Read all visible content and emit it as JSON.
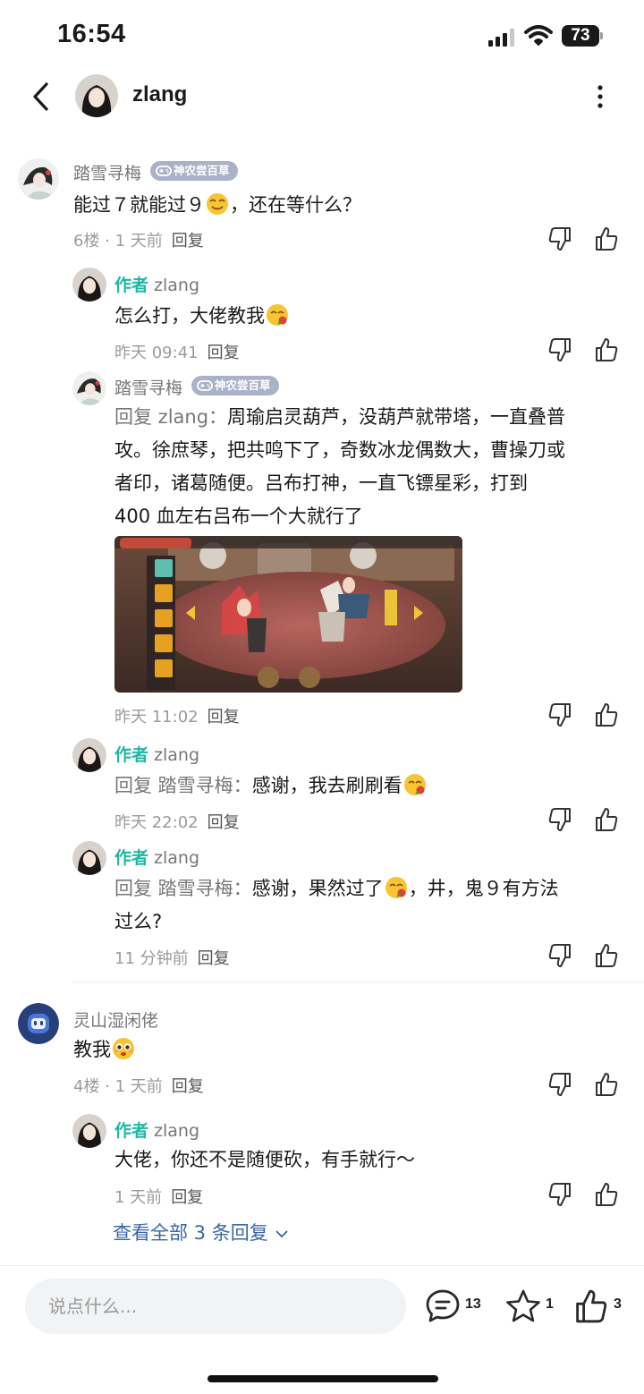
{
  "status_bar": {
    "time": "16:54",
    "battery": "73"
  },
  "header": {
    "username": "zlang"
  },
  "colors": {
    "author_tag": "#1fb7a6",
    "link": "#3866a6",
    "badge": "#a9b2c8",
    "meta": "#9b9b9b"
  },
  "icons": [
    "back-icon",
    "more-icon",
    "signal-icon",
    "wifi-icon",
    "battery-icon",
    "dislike-icon",
    "like-icon",
    "comment-icon",
    "star-icon",
    "thumbs-up-icon",
    "chevron-down-icon",
    "gamepad-icon"
  ],
  "comments": [
    {
      "user": "踏雪寻梅",
      "badge": "神农尝百草",
      "text_a": "能过７就能过９",
      "text_b": "，还在等什么？",
      "meta": "6楼 · 1 天前",
      "reply_label": "回复",
      "replies": [
        {
          "author_tag": "作者",
          "user": "zlang",
          "text": "怎么打，大佬教我",
          "meta": "昨天 09:41",
          "reply_label": "回复"
        },
        {
          "user": "踏雪寻梅",
          "badge": "神农尝百草",
          "reply_prefix": "回复 zlang：",
          "line1": "周瑜启灵葫芦，没葫芦就带塔，一直叠普",
          "line2": "攻。徐庶琴，把共鸣下了，奇数冰龙偶数大，曹操刀或",
          "line3": "者印，诸葛随便。吕布打神，一直飞镖星彩，打到",
          "line4": "400 血左右吕布一个大就行了",
          "image_alt": "game screenshot",
          "meta": "昨天 11:02",
          "reply_label": "回复"
        },
        {
          "author_tag": "作者",
          "user": "zlang",
          "reply_prefix": "回复 踏雪寻梅：",
          "text": "感谢，我去刷刷看",
          "meta": "昨天 22:02",
          "reply_label": "回复"
        },
        {
          "author_tag": "作者",
          "user": "zlang",
          "reply_prefix": "回复 踏雪寻梅：",
          "text_a": "感谢，果然过了",
          "text_b": "，井，鬼９有方法",
          "line2": "过么?",
          "meta": "11 分钟前",
          "reply_label": "回复"
        }
      ]
    },
    {
      "user": "灵山湿闲佬",
      "text": "教我",
      "meta": "4楼 · 1 天前",
      "reply_label": "回复",
      "replies": [
        {
          "author_tag": "作者",
          "user": "zlang",
          "text": "大佬，你还不是随便砍，有手就行～",
          "meta": "1 天前",
          "reply_label": "回复"
        }
      ],
      "view_all": "查看全部 3 条回复"
    }
  ],
  "bottom_bar": {
    "placeholder": "说点什么...",
    "comments_count": "13",
    "favorites_count": "1",
    "likes_count": "3"
  }
}
